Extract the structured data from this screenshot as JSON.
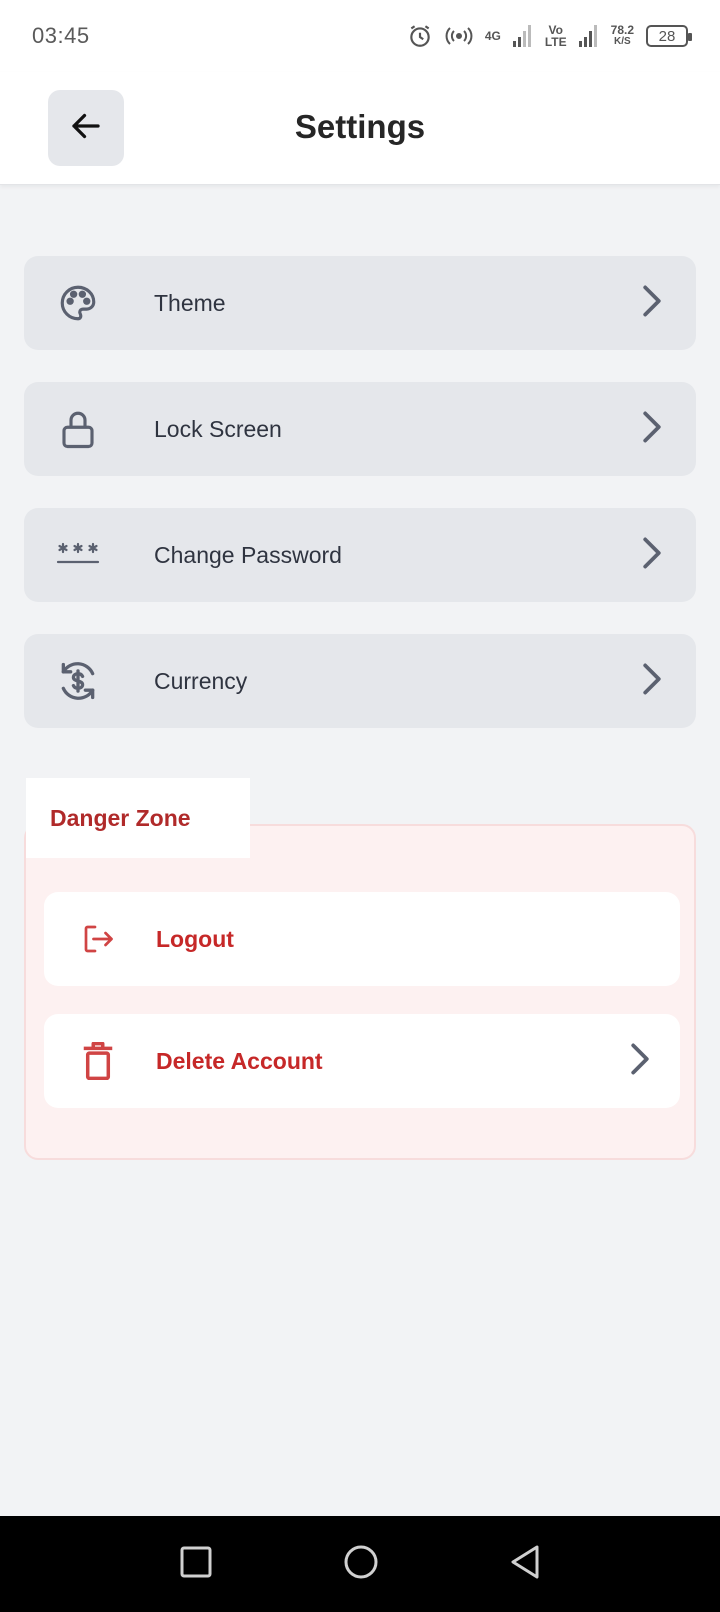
{
  "status_bar": {
    "time": "03:45",
    "network_4g": "4G",
    "volte_top": "Vo",
    "volte_bottom": "LTE",
    "speed_value": "78.2",
    "speed_unit": "K/S",
    "battery": "28"
  },
  "header": {
    "title": "Settings",
    "back_icon": "arrow-left-icon"
  },
  "settings": [
    {
      "label": "Theme",
      "icon": "palette-icon"
    },
    {
      "label": "Lock Screen",
      "icon": "lock-icon"
    },
    {
      "label": "Change Password",
      "icon": "password-icon"
    },
    {
      "label": "Currency",
      "icon": "currency-exchange-icon"
    }
  ],
  "danger_zone": {
    "title": "Danger Zone",
    "logout_label": "Logout",
    "delete_label": "Delete Account"
  },
  "colors": {
    "background": "#f2f3f5",
    "row_background": "#e5e7eb",
    "danger_text": "#c62828",
    "danger_background": "#fdf1f1"
  }
}
